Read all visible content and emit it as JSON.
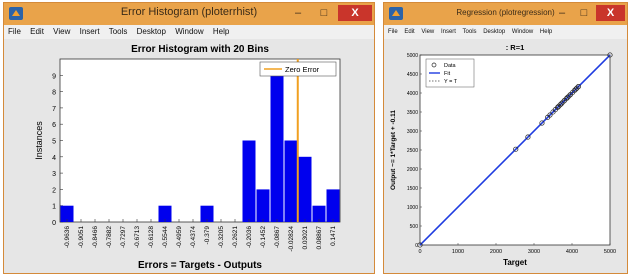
{
  "window1": {
    "title": "Error Histogram (ploterrhist)",
    "controls": {
      "minimize": "–",
      "maximize": "□",
      "close": "X"
    },
    "menu": [
      "File",
      "Edit",
      "View",
      "Insert",
      "Tools",
      "Desktop",
      "Window",
      "Help"
    ]
  },
  "window2": {
    "title": "Regression (plotregression)",
    "controls": {
      "minimize": "–",
      "maximize": "□",
      "close": "X"
    },
    "menu": [
      "File",
      "Edit",
      "View",
      "Insert",
      "Tools",
      "Desktop",
      "Window",
      "Help"
    ]
  },
  "colors": {
    "bar": "#0000ee",
    "zero_line": "#f0a020",
    "fit_line": "#1f3ce0",
    "titlebar": "#e9a34a",
    "close": "#c9352b"
  },
  "chart_data": [
    {
      "type": "bar",
      "title": "Error Histogram with 20 Bins",
      "xlabel": "Errors = Targets - Outputs",
      "ylabel": "Instances",
      "categories": [
        "-0.9636",
        "-0.9051",
        "-0.8466",
        "-0.7882",
        "-0.7297",
        "-0.6713",
        "-0.6128",
        "-0.5544",
        "-0.4959",
        "-0.4374",
        "-0.379",
        "-0.3205",
        "-0.2621",
        "-0.2036",
        "-0.1452",
        "-0.0867",
        "-0.02824",
        "0.03021",
        "0.08867",
        "0.1471"
      ],
      "values": [
        1,
        0,
        0,
        0,
        0,
        0,
        0,
        1,
        0,
        0,
        1,
        0,
        0,
        5,
        2,
        9,
        5,
        4,
        1,
        2
      ],
      "ylim": [
        0,
        10
      ],
      "yticks": [
        0,
        1,
        2,
        3,
        4,
        5,
        6,
        7,
        8,
        9
      ],
      "legend": {
        "entries": [
          "Zero Error"
        ],
        "placement": "top-right"
      },
      "zero_error_x": 0
    },
    {
      "type": "scatter",
      "title": ": R=1",
      "xlabel": "Target",
      "ylabel": "Output ~= 1*Target + -0.11",
      "xlim": [
        0,
        5000
      ],
      "ylim": [
        0,
        5000
      ],
      "xticks": [
        0,
        1000,
        2000,
        3000,
        4000,
        5000
      ],
      "yticks": [
        0,
        500,
        1000,
        1500,
        2000,
        2500,
        3000,
        3500,
        4000,
        4500,
        5000
      ],
      "legend": {
        "entries": [
          "Data",
          "Fit",
          "Y = T"
        ],
        "placement": "top-left"
      },
      "fit": {
        "slope": 1,
        "intercept": -0.11
      },
      "series": [
        {
          "name": "Data",
          "x": [
            0,
            2520,
            2840,
            3210,
            3360,
            3420,
            3500,
            3560,
            3620,
            3650,
            3690,
            3720,
            3760,
            3800,
            3850,
            3880,
            3920,
            3960,
            4010,
            4060,
            4100,
            4130,
            4170,
            5000
          ],
          "y": [
            0,
            2520,
            2840,
            3210,
            3360,
            3420,
            3500,
            3560,
            3620,
            3650,
            3690,
            3720,
            3760,
            3800,
            3850,
            3880,
            3920,
            3960,
            4010,
            4060,
            4100,
            4130,
            4170,
            5000
          ]
        }
      ]
    }
  ]
}
